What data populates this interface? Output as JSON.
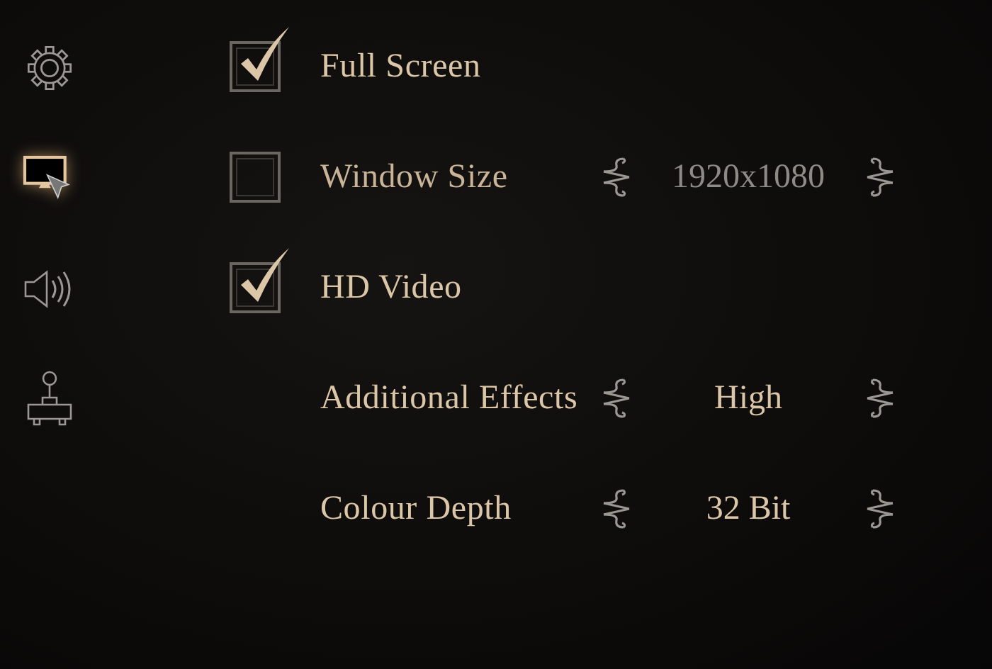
{
  "sidebar": {
    "items": [
      {
        "kind": "settings",
        "selected": false
      },
      {
        "kind": "display",
        "selected": true
      },
      {
        "kind": "sound",
        "selected": false
      },
      {
        "kind": "controller",
        "selected": false
      }
    ]
  },
  "options": [
    {
      "kind": "toggle",
      "label": "Full Screen",
      "checked": true
    },
    {
      "kind": "toggle-select",
      "label": "Window Size",
      "checked": false,
      "value": "1920x1080",
      "disabled": true
    },
    {
      "kind": "toggle",
      "label": "HD Video",
      "checked": true
    },
    {
      "kind": "select",
      "label": "Additional Effects",
      "value": "High"
    },
    {
      "kind": "select",
      "label": "Colour Depth",
      "value": "32 Bit"
    }
  ]
}
